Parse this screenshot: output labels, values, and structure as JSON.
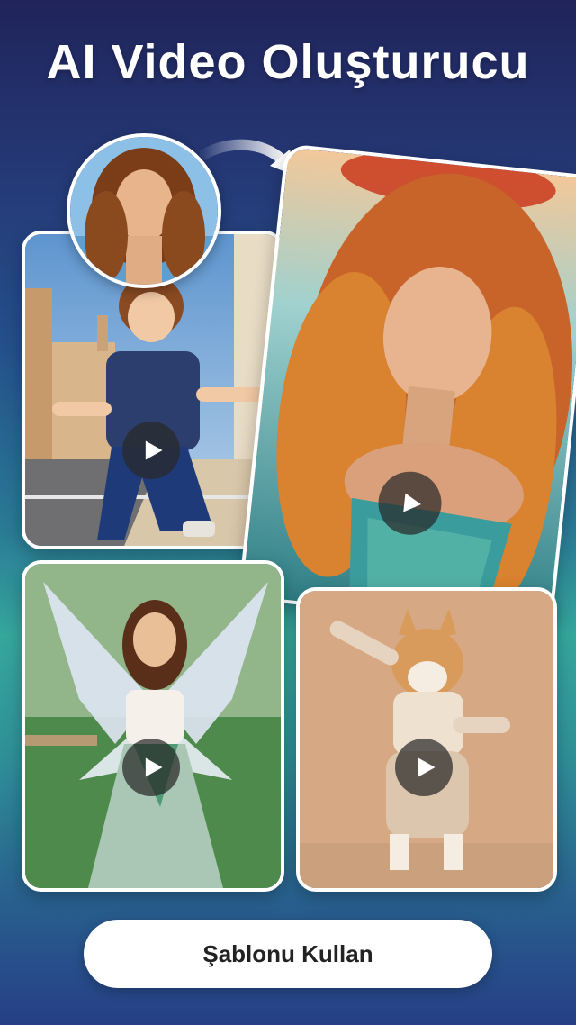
{
  "header": {
    "title": "AI Video Oluşturucu"
  },
  "cards": {
    "boy": {
      "icon": "play-icon"
    },
    "mermaid": {
      "icon": "play-icon"
    },
    "fairy": {
      "icon": "play-icon"
    },
    "dog": {
      "icon": "play-icon"
    }
  },
  "cta": {
    "label": "Şablonu Kullan"
  },
  "colors": {
    "accent": "#ffffff",
    "background_top": "#20245a",
    "background_mid": "#35a79c"
  }
}
